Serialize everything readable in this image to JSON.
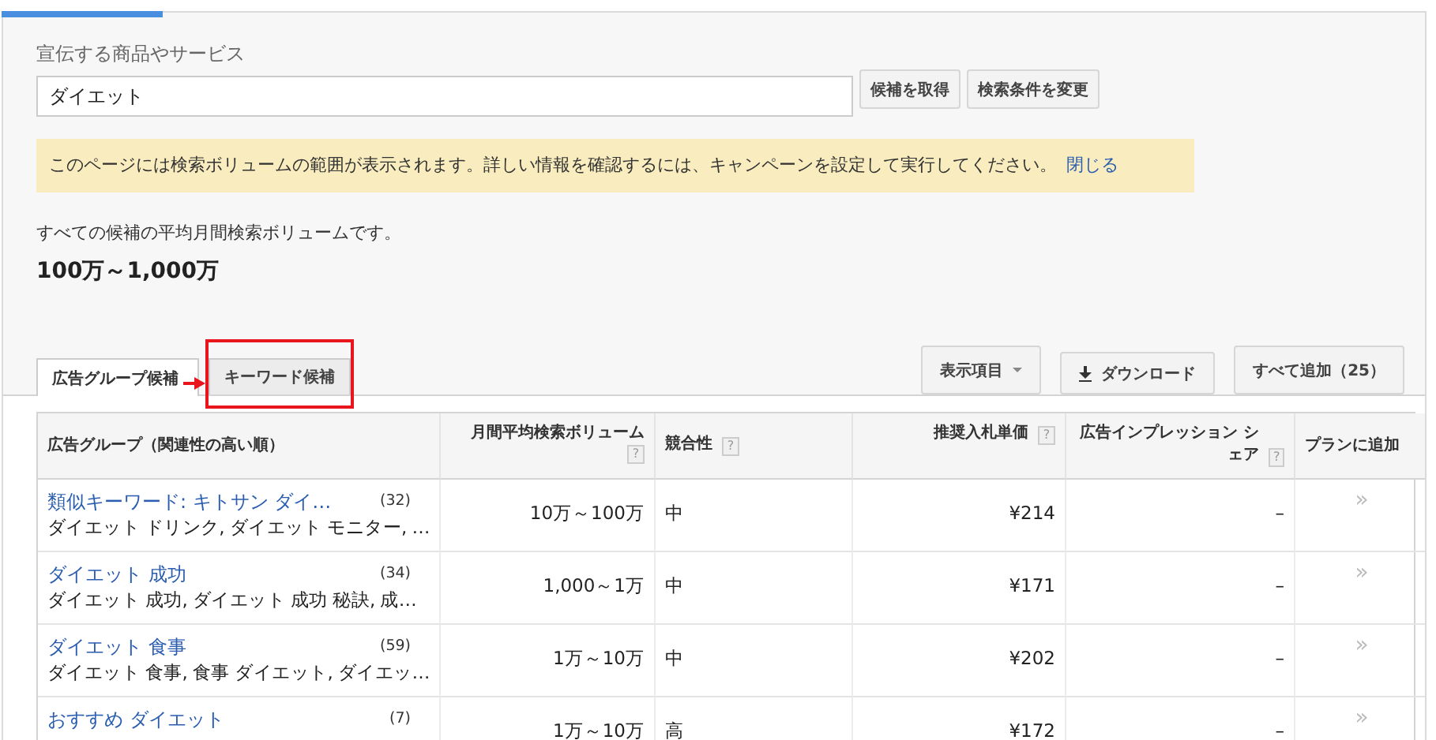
{
  "loading_bar": {
    "level": 0.113
  },
  "search": {
    "label": "宣伝する商品やサービス",
    "value": "ダイエット",
    "buttons": [
      "候補を取得",
      "検索条件を変更"
    ]
  },
  "notice": {
    "text": "このページには検索ボリュームの範囲が表示されます。詳しい情報を確認するには、キャンペーンを設定して実行してください。",
    "link": "閉じる"
  },
  "summary": {
    "caption": "すべての候補の平均月間検索ボリュームです。",
    "value": "100万～1,000万"
  },
  "tabs": [
    {
      "label": "広告グループ候補",
      "selected": true,
      "highlighted": false
    },
    {
      "label": "キーワード候補",
      "selected": false,
      "highlighted": true
    }
  ],
  "toolbar": {
    "columns_button": "表示項目",
    "download_button": "ダウンロード",
    "add_all_button": "すべて追加（25）"
  },
  "table": {
    "columns": [
      {
        "label": "広告グループ（関連性の高い順）"
      },
      {
        "label": "月間平均検索ボリューム",
        "help": "?"
      },
      {
        "label": "競合性",
        "help": "?"
      },
      {
        "label": "推奨入札単価",
        "help": "?"
      },
      {
        "label": "広告インプレッション シェア",
        "help": "?"
      },
      {
        "label": "プランに追加"
      }
    ],
    "rows": [
      {
        "group": "類似キーワード: キトサン ダイ…",
        "count": "(32)",
        "keywords": "ダイエット ドリンク, ダイエット モニター, …",
        "volume": "10万～100万",
        "competition": "中",
        "bid": "¥214",
        "share": "–",
        "add": "»"
      },
      {
        "group": "ダイエット 成功",
        "count": "(34)",
        "keywords": "ダイエット 成功, ダイエット 成功 秘訣, 成…",
        "volume": "1,000～1万",
        "competition": "中",
        "bid": "¥171",
        "share": "–",
        "add": "»"
      },
      {
        "group": "ダイエット 食事",
        "count": "(59)",
        "keywords": "ダイエット 食事, 食事 ダイエット, ダイエッ…",
        "volume": "1万～10万",
        "competition": "中",
        "bid": "¥202",
        "share": "–",
        "add": "»"
      },
      {
        "group": "おすすめ ダイエット",
        "count": "(7)",
        "volume": "1万～10万",
        "competition": "高",
        "bid": "¥172",
        "share": "–",
        "add": "»"
      }
    ]
  }
}
